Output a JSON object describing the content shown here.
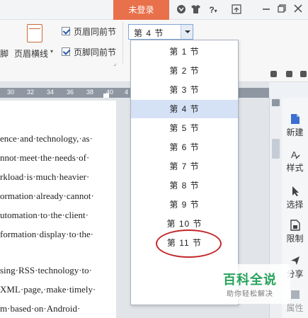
{
  "titlebar": {
    "login_label": "未登录",
    "help_label": "?"
  },
  "ribbon": {
    "left_cut_label": "脚",
    "header_line_label": "页眉横线",
    "header_same_label": "页眉同前节",
    "footer_same_label": "页脚同前节",
    "section_select_value": "第 4 节"
  },
  "ruler": {
    "ticks": [
      "30",
      "32",
      "34",
      "36",
      "38",
      "40",
      "4"
    ]
  },
  "document": {
    "lines": [
      "ence·and·technology,·as·",
      "nnot·meet·the·needs·of·",
      "rkload·is·much·heavier·",
      "ormation·already·cannot·",
      "utomation·to·the·client·",
      "formation·display·to·the·",
      "sing·RSS·technology·to·",
      "XML·page,·make·timely·",
      "m·based·on·Android·"
    ]
  },
  "dropdown": {
    "items": [
      "第 1 节",
      "第 2 节",
      "第 3 节",
      "第 4 节",
      "第 5 节",
      "第 6 节",
      "第 7 节",
      "第 8 节",
      "第 9 节",
      "第 10 节",
      "第 11 节"
    ],
    "selected_index": 3
  },
  "right_panel": {
    "items": [
      "新建",
      "样式",
      "选择",
      "限制",
      "分享",
      "属性"
    ]
  },
  "watermark": {
    "title": "百科全说",
    "subtitle": "助你轻松解决"
  },
  "colors": {
    "login_bg": "#e8704a",
    "selection": "#d5e1f5",
    "annotation_circle": "#c3272b",
    "watermark_green": "#27a35b"
  }
}
